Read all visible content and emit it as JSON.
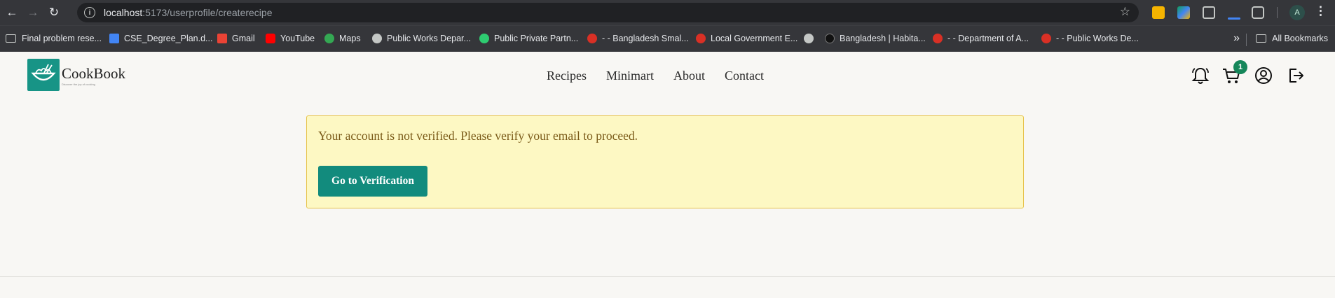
{
  "browser": {
    "url_host": "localhost",
    "url_path": ":5173/userprofile/createrecipe",
    "profile_initial": "A",
    "bookmarks": [
      {
        "label": "Final problem rese...",
        "icon": "folder-icon"
      },
      {
        "label": "CSE_Degree_Plan.d...",
        "icon": "docs-icon",
        "color": "#4285f4"
      },
      {
        "label": "Gmail",
        "icon": "gmail-icon",
        "color": "#ea4335"
      },
      {
        "label": "YouTube",
        "icon": "youtube-icon",
        "color": "#ff0000"
      },
      {
        "label": "Maps",
        "icon": "maps-icon",
        "color": "#34a853"
      },
      {
        "label": "Public Works Depar...",
        "icon": "globe-icon",
        "color": "#c4c7c5"
      },
      {
        "label": "Public Private Partn...",
        "icon": "ppp-icon",
        "color": "#2ecc71"
      },
      {
        "label": "- - Bangladesh Smal...",
        "icon": "bd-gov-icon",
        "color": "#d93025"
      },
      {
        "label": "Local Government E...",
        "icon": "bd-gov-icon",
        "color": "#d93025"
      },
      {
        "label": "",
        "icon": "globe-icon",
        "color": "#c4c7c5"
      },
      {
        "label": "Bangladesh | Habita...",
        "icon": "habitat-icon",
        "color": "#111111"
      },
      {
        "label": "- - Department of A...",
        "icon": "bd-gov-icon",
        "color": "#d93025"
      },
      {
        "label": "- - Public Works De...",
        "icon": "bd-gov-icon",
        "color": "#d93025"
      }
    ],
    "all_bookmarks_label": "All Bookmarks"
  },
  "header": {
    "brand": "CookBook",
    "brand_tagline": "Discover the joy of cooking",
    "nav": [
      "Recipes",
      "Minimart",
      "About",
      "Contact"
    ],
    "cart_count": "1"
  },
  "alert": {
    "message": "Your account is not verified. Please verify your email to proceed.",
    "button_label": "Go to Verification"
  },
  "colors": {
    "accent": "#128b7d",
    "alert_bg": "#fdf8c3",
    "alert_border": "#e7c44e",
    "alert_text": "#7a5a18",
    "badge": "#16875a"
  }
}
